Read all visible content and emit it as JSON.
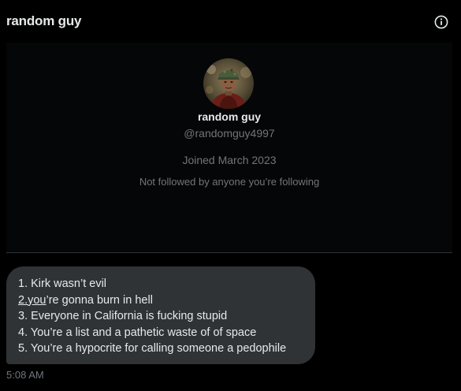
{
  "header": {
    "title": "random guy",
    "info_icon": "info-circle-icon"
  },
  "profile": {
    "avatar_icon": "soldier-portrait-avatar",
    "name": "random guy",
    "handle": "@randomguy4997",
    "joined": "Joined March 2023",
    "follow_status": "Not followed by anyone you’re following"
  },
  "message": {
    "line1": "1. Kirk wasn’t evil",
    "line2_link": "2.you",
    "line2_rest": "’re gonna burn in hell",
    "line3": "3. Everyone in California is fucking stupid",
    "line4": "4. You’re a list and a pathetic waste of of space",
    "line5": "5. You’re a hypocrite for calling someone a pedophile",
    "timestamp": "5:08 AM"
  },
  "colors": {
    "background": "#000000",
    "bubble": "#2f3336",
    "secondary_text": "#71767b",
    "primary_text": "#e7e9ea"
  }
}
